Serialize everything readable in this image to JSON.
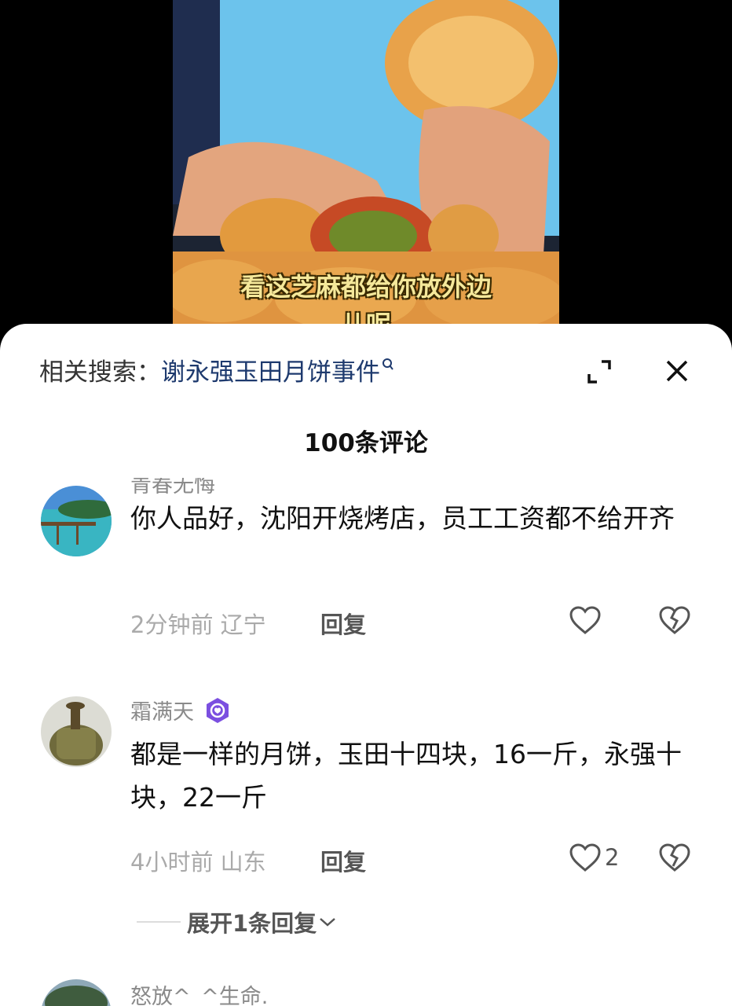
{
  "video": {
    "subtitle_line1": "看这芝麻都给你放外边",
    "subtitle_line2": "儿呢"
  },
  "header": {
    "related_label": "相关搜索：",
    "related_term": "谢永强玉田月饼事件",
    "comment_count": "100条评论"
  },
  "comments": [
    {
      "username": "青春无悔",
      "text": "你人品好，沈阳开烧烤店，员工工资都不给开齐",
      "time_location": "2分钟前 辽宁",
      "reply_label": "回复",
      "likes": ""
    },
    {
      "username": "霜满天",
      "text": "都是一样的月饼，玉田十四块，16一斤，永强十块，22一斤",
      "time_location": "4小时前 山东",
      "reply_label": "回复",
      "likes": "2",
      "expand_label": "展开1条回复"
    },
    {
      "username": "怒放^_^生命."
    }
  ],
  "colors": {
    "accent_badge": "#7b4fe0",
    "link": "#1e3a6e"
  }
}
